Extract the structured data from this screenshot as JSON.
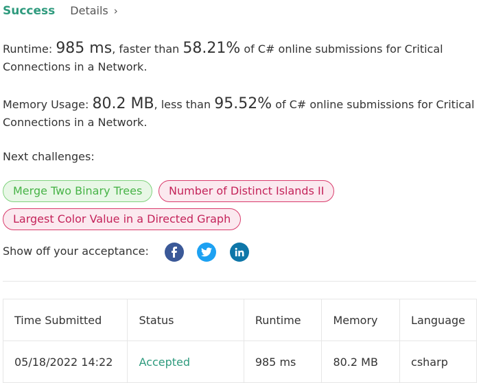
{
  "header": {
    "status": "Success",
    "details_label": "Details",
    "details_chevron": "›"
  },
  "runtime": {
    "label": "Runtime: ",
    "value": "985 ms",
    "compare_text": ", faster than ",
    "percent": "58.21%",
    "suffix": " of C# online submissions for Critical Connections in a Network."
  },
  "memory": {
    "label": "Memory Usage: ",
    "value": "80.2 MB",
    "compare_text": ", less than ",
    "percent": "95.52%",
    "suffix": " of C# online submissions for Critical Connections in a Network."
  },
  "next_challenges": {
    "label": "Next challenges:",
    "items": [
      {
        "label": "Merge Two Binary Trees",
        "difficulty": "easy"
      },
      {
        "label": "Number of Distinct Islands II",
        "difficulty": "hard"
      },
      {
        "label": "Largest Color Value in a Directed Graph",
        "difficulty": "hard"
      }
    ]
  },
  "share": {
    "label": "Show off your acceptance:",
    "icons": [
      "facebook-icon",
      "twitter-icon",
      "linkedin-icon"
    ]
  },
  "table": {
    "headers": [
      "Time Submitted",
      "Status",
      "Runtime",
      "Memory",
      "Language"
    ],
    "rows": [
      [
        "05/18/2022 14:22",
        "Accepted",
        "985 ms",
        "80.2 MB",
        "csharp"
      ]
    ]
  },
  "colors": {
    "success": "#2e9a7d",
    "easy": "#47b347",
    "hard": "#c4235a",
    "facebook": "#3b5998",
    "twitter": "#1da1f2",
    "linkedin": "#0e76a8"
  }
}
